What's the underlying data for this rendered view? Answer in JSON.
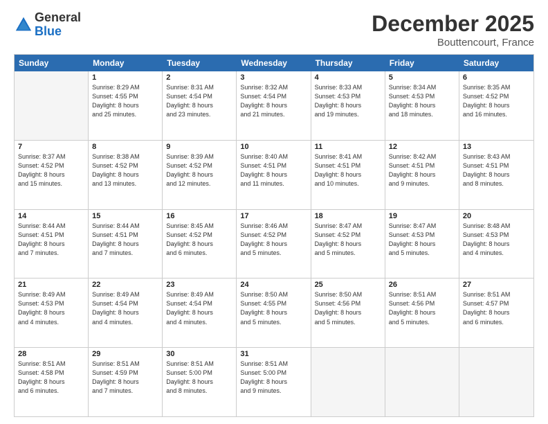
{
  "logo": {
    "general": "General",
    "blue": "Blue"
  },
  "header": {
    "month": "December 2025",
    "location": "Bouttencourt, France"
  },
  "weekdays": [
    "Sunday",
    "Monday",
    "Tuesday",
    "Wednesday",
    "Thursday",
    "Friday",
    "Saturday"
  ],
  "rows": [
    [
      {
        "day": "",
        "info": "",
        "empty": true
      },
      {
        "day": "1",
        "info": "Sunrise: 8:29 AM\nSunset: 4:55 PM\nDaylight: 8 hours\nand 25 minutes."
      },
      {
        "day": "2",
        "info": "Sunrise: 8:31 AM\nSunset: 4:54 PM\nDaylight: 8 hours\nand 23 minutes."
      },
      {
        "day": "3",
        "info": "Sunrise: 8:32 AM\nSunset: 4:54 PM\nDaylight: 8 hours\nand 21 minutes."
      },
      {
        "day": "4",
        "info": "Sunrise: 8:33 AM\nSunset: 4:53 PM\nDaylight: 8 hours\nand 19 minutes."
      },
      {
        "day": "5",
        "info": "Sunrise: 8:34 AM\nSunset: 4:53 PM\nDaylight: 8 hours\nand 18 minutes."
      },
      {
        "day": "6",
        "info": "Sunrise: 8:35 AM\nSunset: 4:52 PM\nDaylight: 8 hours\nand 16 minutes."
      }
    ],
    [
      {
        "day": "7",
        "info": "Sunrise: 8:37 AM\nSunset: 4:52 PM\nDaylight: 8 hours\nand 15 minutes."
      },
      {
        "day": "8",
        "info": "Sunrise: 8:38 AM\nSunset: 4:52 PM\nDaylight: 8 hours\nand 13 minutes."
      },
      {
        "day": "9",
        "info": "Sunrise: 8:39 AM\nSunset: 4:52 PM\nDaylight: 8 hours\nand 12 minutes."
      },
      {
        "day": "10",
        "info": "Sunrise: 8:40 AM\nSunset: 4:51 PM\nDaylight: 8 hours\nand 11 minutes."
      },
      {
        "day": "11",
        "info": "Sunrise: 8:41 AM\nSunset: 4:51 PM\nDaylight: 8 hours\nand 10 minutes."
      },
      {
        "day": "12",
        "info": "Sunrise: 8:42 AM\nSunset: 4:51 PM\nDaylight: 8 hours\nand 9 minutes."
      },
      {
        "day": "13",
        "info": "Sunrise: 8:43 AM\nSunset: 4:51 PM\nDaylight: 8 hours\nand 8 minutes."
      }
    ],
    [
      {
        "day": "14",
        "info": "Sunrise: 8:44 AM\nSunset: 4:51 PM\nDaylight: 8 hours\nand 7 minutes."
      },
      {
        "day": "15",
        "info": "Sunrise: 8:44 AM\nSunset: 4:51 PM\nDaylight: 8 hours\nand 7 minutes."
      },
      {
        "day": "16",
        "info": "Sunrise: 8:45 AM\nSunset: 4:52 PM\nDaylight: 8 hours\nand 6 minutes."
      },
      {
        "day": "17",
        "info": "Sunrise: 8:46 AM\nSunset: 4:52 PM\nDaylight: 8 hours\nand 5 minutes."
      },
      {
        "day": "18",
        "info": "Sunrise: 8:47 AM\nSunset: 4:52 PM\nDaylight: 8 hours\nand 5 minutes."
      },
      {
        "day": "19",
        "info": "Sunrise: 8:47 AM\nSunset: 4:53 PM\nDaylight: 8 hours\nand 5 minutes."
      },
      {
        "day": "20",
        "info": "Sunrise: 8:48 AM\nSunset: 4:53 PM\nDaylight: 8 hours\nand 4 minutes."
      }
    ],
    [
      {
        "day": "21",
        "info": "Sunrise: 8:49 AM\nSunset: 4:53 PM\nDaylight: 8 hours\nand 4 minutes."
      },
      {
        "day": "22",
        "info": "Sunrise: 8:49 AM\nSunset: 4:54 PM\nDaylight: 8 hours\nand 4 minutes."
      },
      {
        "day": "23",
        "info": "Sunrise: 8:49 AM\nSunset: 4:54 PM\nDaylight: 8 hours\nand 4 minutes."
      },
      {
        "day": "24",
        "info": "Sunrise: 8:50 AM\nSunset: 4:55 PM\nDaylight: 8 hours\nand 5 minutes."
      },
      {
        "day": "25",
        "info": "Sunrise: 8:50 AM\nSunset: 4:56 PM\nDaylight: 8 hours\nand 5 minutes."
      },
      {
        "day": "26",
        "info": "Sunrise: 8:51 AM\nSunset: 4:56 PM\nDaylight: 8 hours\nand 5 minutes."
      },
      {
        "day": "27",
        "info": "Sunrise: 8:51 AM\nSunset: 4:57 PM\nDaylight: 8 hours\nand 6 minutes."
      }
    ],
    [
      {
        "day": "28",
        "info": "Sunrise: 8:51 AM\nSunset: 4:58 PM\nDaylight: 8 hours\nand 6 minutes."
      },
      {
        "day": "29",
        "info": "Sunrise: 8:51 AM\nSunset: 4:59 PM\nDaylight: 8 hours\nand 7 minutes."
      },
      {
        "day": "30",
        "info": "Sunrise: 8:51 AM\nSunset: 5:00 PM\nDaylight: 8 hours\nand 8 minutes."
      },
      {
        "day": "31",
        "info": "Sunrise: 8:51 AM\nSunset: 5:00 PM\nDaylight: 8 hours\nand 9 minutes."
      },
      {
        "day": "",
        "info": "",
        "empty": true
      },
      {
        "day": "",
        "info": "",
        "empty": true
      },
      {
        "day": "",
        "info": "",
        "empty": true
      }
    ]
  ]
}
